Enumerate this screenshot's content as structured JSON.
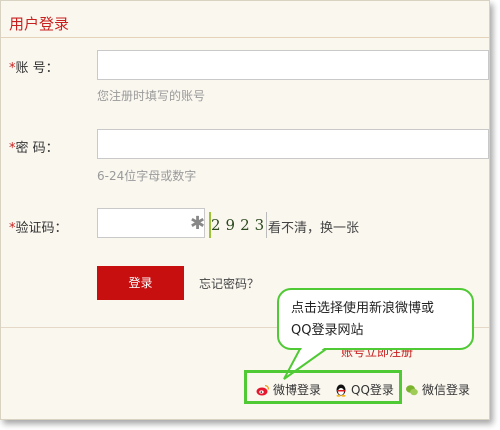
{
  "form": {
    "title": "用户登录",
    "account": {
      "required": "*",
      "label": "账 号：",
      "hint": "您注册时填写的账号",
      "value": ""
    },
    "password": {
      "required": "*",
      "label": "密 码：",
      "hint": "6-24位字母或数字",
      "value": ""
    },
    "captcha": {
      "required": "*",
      "label": "验证码：",
      "code": "2923",
      "refresh_text": "看不清，换一张"
    },
    "login_button": "登录",
    "forgot_password": "忘记密码？",
    "register_link": "账号立即注册"
  },
  "callout": {
    "line1": "点击选择使用新浪微博或",
    "line2": "QQ登录网站"
  },
  "social": {
    "weibo": "微博登录",
    "qq": "QQ登录",
    "wechat": "微信登录"
  },
  "colors": {
    "brand": "#c80f10",
    "highlight": "#4fc934"
  }
}
